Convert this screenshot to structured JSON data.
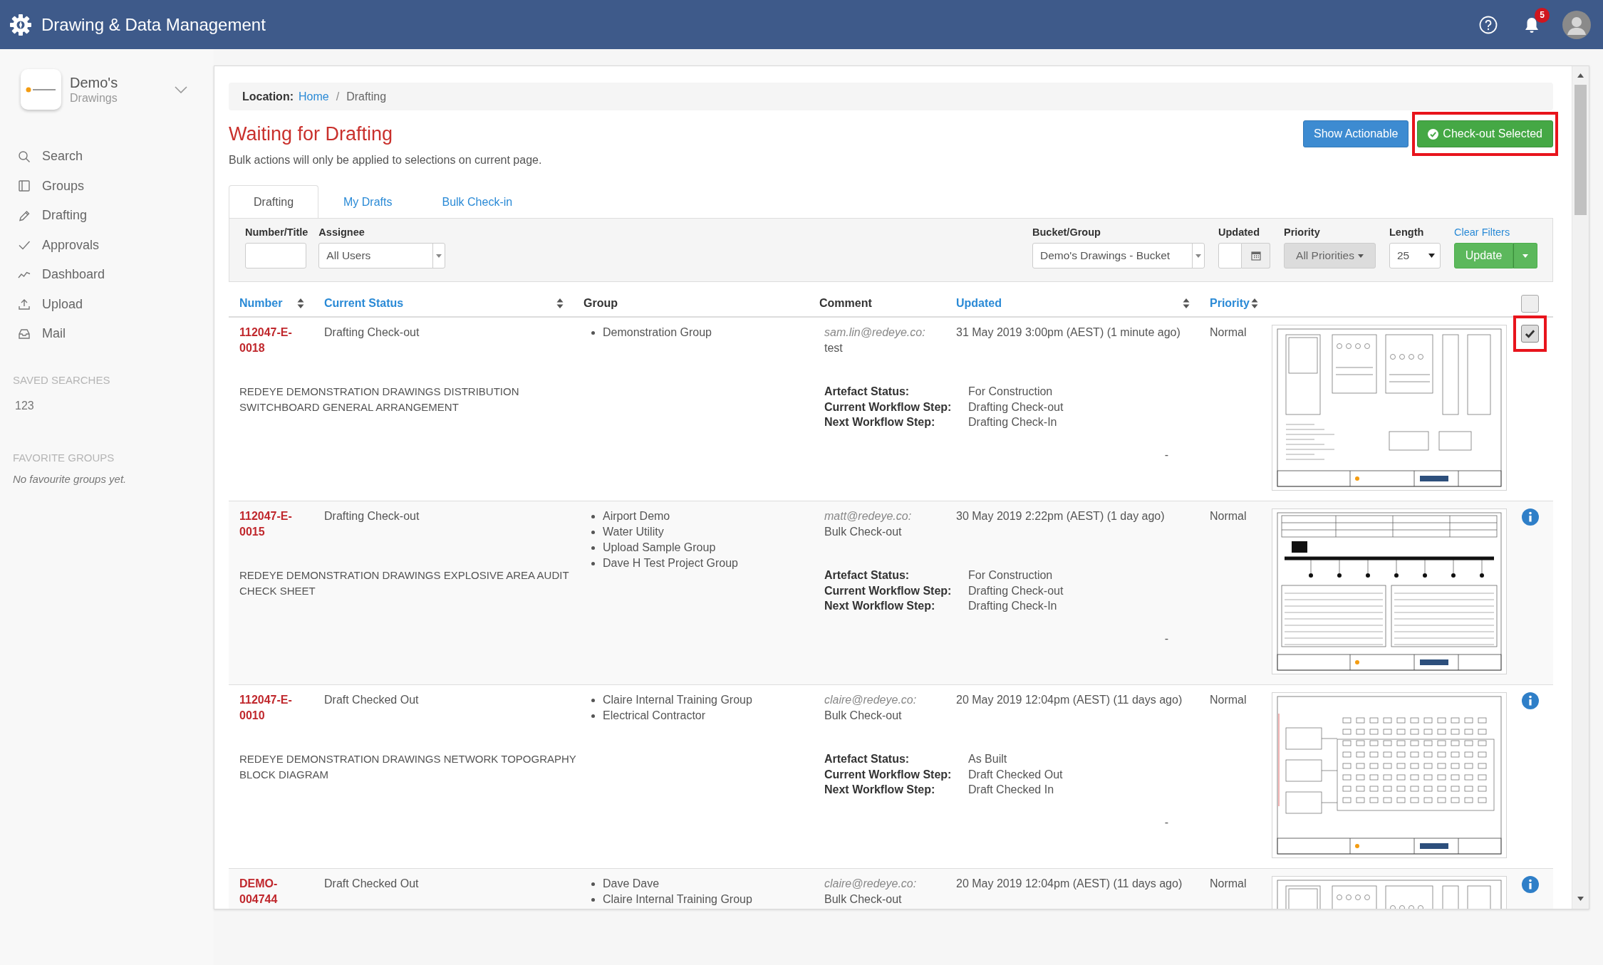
{
  "header": {
    "title": "Drawing & Data Management",
    "notification_count": "5"
  },
  "sidebar": {
    "org": {
      "name": "Demo's",
      "subtitle": "Drawings"
    },
    "items": [
      {
        "label": "Search"
      },
      {
        "label": "Groups"
      },
      {
        "label": "Drafting"
      },
      {
        "label": "Approvals"
      },
      {
        "label": "Dashboard"
      },
      {
        "label": "Upload"
      },
      {
        "label": "Mail"
      }
    ],
    "saved_searches": {
      "heading": "SAVED SEARCHES",
      "items": [
        "123"
      ]
    },
    "favorite_groups": {
      "heading": "FAVORITE GROUPS",
      "empty_text": "No favourite groups yet."
    }
  },
  "breadcrumb": {
    "label": "Location:",
    "separator": "/",
    "items": [
      {
        "text": "Home",
        "link": true
      },
      {
        "text": "Drafting",
        "link": false
      }
    ]
  },
  "page": {
    "title": "Waiting for Drafting",
    "note": "Bulk actions will only be applied to selections on current page."
  },
  "actions": [
    {
      "label": "Show Actionable",
      "kind": "primary",
      "highlighted": false
    },
    {
      "label": "Check-out Selected",
      "kind": "confirm",
      "highlighted": true
    }
  ],
  "tabs": [
    {
      "label": "Drafting",
      "selected": true
    },
    {
      "label": "My Drafts",
      "selected": false
    },
    {
      "label": "Bulk Check-in",
      "selected": false
    }
  ],
  "filters": {
    "left": [
      {
        "label": "Number/Title",
        "kind": "text"
      },
      {
        "label": "Assignee",
        "kind": "combo",
        "value": "All Users"
      }
    ],
    "right": [
      {
        "label": "Bucket/Group",
        "kind": "combo",
        "value": "Demo's Drawings - Bucket"
      },
      {
        "label": "Updated",
        "kind": "date"
      },
      {
        "label": "Priority",
        "kind": "dropdown",
        "value": "All Priorities"
      },
      {
        "label": "Length",
        "kind": "select",
        "value": "25"
      }
    ],
    "clear_link": "Clear Filters",
    "submit": "Update"
  },
  "table": {
    "columns": [
      {
        "label": "Number",
        "sortable": true
      },
      {
        "label": "Current Status",
        "sortable": true
      },
      {
        "label": "Group",
        "sortable": false
      },
      {
        "label": "Comment",
        "sortable": false
      },
      {
        "label": "Updated",
        "sortable": true
      },
      {
        "label": "Priority",
        "sortable": true
      }
    ],
    "select_all": {
      "checked": false
    },
    "rows": [
      {
        "number": "112047-E-0018",
        "status": "Drafting Check-out",
        "groups": [
          "Demonstration Group"
        ],
        "comment_author": "sam.lin@redeye.co:",
        "comment": "test",
        "updated": "31 May 2019 3:00pm (AEST) (1 minute ago)",
        "priority": "Normal",
        "title": "REDEYE DEMONSTRATION DRAWINGS DISTRIBUTION SWITCHBOARD GENERAL ARRANGEMENT",
        "details": [
          {
            "label": "Artefact Status:",
            "value": "For Construction"
          },
          {
            "label": "Current Workflow Step:",
            "value": "Drafting Check-out"
          },
          {
            "label": "Next Workflow Step:",
            "value": "Drafting Check-In"
          }
        ],
        "note": "-",
        "control": {
          "kind": "checkbox",
          "checked": true,
          "highlighted": true
        }
      },
      {
        "number": "112047-E-0015",
        "status": "Drafting Check-out",
        "groups": [
          "Airport Demo",
          "Water Utility",
          "Upload Sample Group",
          "Dave H Test Project Group"
        ],
        "comment_author": "matt@redeye.co:",
        "comment": "Bulk Check-out",
        "updated": "30 May 2019 2:22pm (AEST) (1 day ago)",
        "priority": "Normal",
        "title": "REDEYE DEMONSTRATION DRAWINGS EXPLOSIVE AREA AUDIT CHECK SHEET",
        "details": [
          {
            "label": "Artefact Status:",
            "value": "For Construction"
          },
          {
            "label": "Current Workflow Step:",
            "value": "Drafting Check-out"
          },
          {
            "label": "Next Workflow Step:",
            "value": "Drafting Check-In"
          }
        ],
        "note": "-",
        "control": {
          "kind": "info"
        }
      },
      {
        "number": "112047-E-0010",
        "status": "Draft Checked Out",
        "groups": [
          "Claire Internal Training Group",
          "Electrical Contractor"
        ],
        "comment_author": "claire@redeye.co:",
        "comment": "Bulk Check-out",
        "updated": "20 May 2019 12:04pm (AEST) (11 days ago)",
        "priority": "Normal",
        "title": "REDEYE DEMONSTRATION DRAWINGS NETWORK TOPOGRAPHY BLOCK DIAGRAM",
        "details": [
          {
            "label": "Artefact Status:",
            "value": "As Built"
          },
          {
            "label": "Current Workflow Step:",
            "value": "Draft Checked Out"
          },
          {
            "label": "Next Workflow Step:",
            "value": "Draft Checked In"
          }
        ],
        "note": "-",
        "control": {
          "kind": "info"
        }
      },
      {
        "number": "DEMO-004744",
        "status": "Draft Checked Out",
        "groups": [
          "Dave Dave",
          "Claire Internal Training Group"
        ],
        "comment_author": "claire@redeye.co:",
        "comment": "Bulk Check-out",
        "updated": "20 May 2019 12:04pm (AEST) (11 days ago)",
        "priority": "Normal",
        "control": {
          "kind": "info"
        }
      }
    ]
  }
}
